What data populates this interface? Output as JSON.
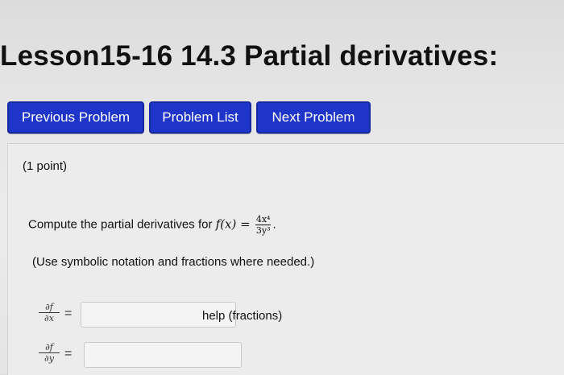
{
  "page": {
    "title": "Lesson15-16 14.3 Partial derivatives:"
  },
  "nav": {
    "previous_label": "Previous Problem",
    "list_label": "Problem List",
    "next_label": "Next Problem"
  },
  "problem": {
    "points": "(1 point)",
    "prompt": "Compute the partial derivatives for",
    "function_lhs": "f(x) =",
    "numerator": "4x⁴",
    "denominator": "3y³",
    "period": ".",
    "note": "(Use symbolic notation and fractions where needed.)"
  },
  "answers": [
    {
      "num": "∂f",
      "den": "∂x",
      "equals": "=",
      "value": ""
    },
    {
      "num": "∂f",
      "den": "∂y",
      "equals": "=",
      "value": ""
    }
  ],
  "help_link": "help (fractions)",
  "colors": {
    "button_bg": "#1f35c9",
    "button_text": "#ffffff"
  }
}
